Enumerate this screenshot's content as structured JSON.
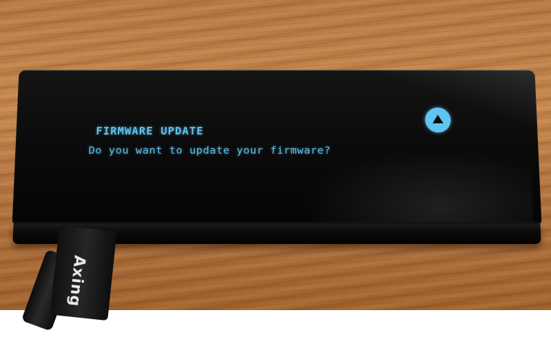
{
  "screen": {
    "title": "FIRMWARE UPDATE",
    "message": "Do you want to update your firmware?",
    "text_color": "#5fc4ef",
    "button_icon": "up-triangle-icon"
  },
  "cable": {
    "logo_text": "Axing"
  },
  "colors": {
    "device_body": "#0a0a0a",
    "wood": "#b97a45"
  }
}
